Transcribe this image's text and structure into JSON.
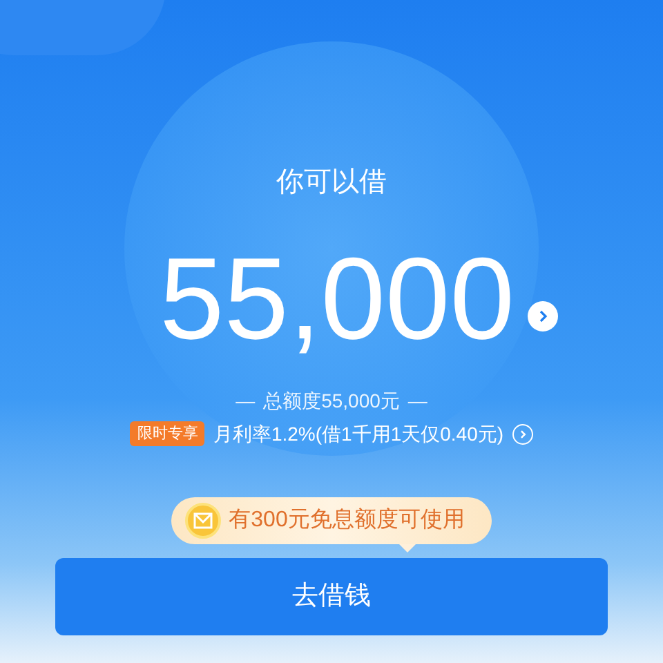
{
  "heading": "你可以借",
  "amount": "55,000",
  "total_line": {
    "dash_left": "—",
    "text": "总额度55,000元",
    "dash_right": "—"
  },
  "promo": {
    "badge": "限时专享",
    "text": "月利率1.2%(借1千用1天仅0.40元)"
  },
  "tip": "有300元免息额度可使用",
  "button": "去借钱"
}
